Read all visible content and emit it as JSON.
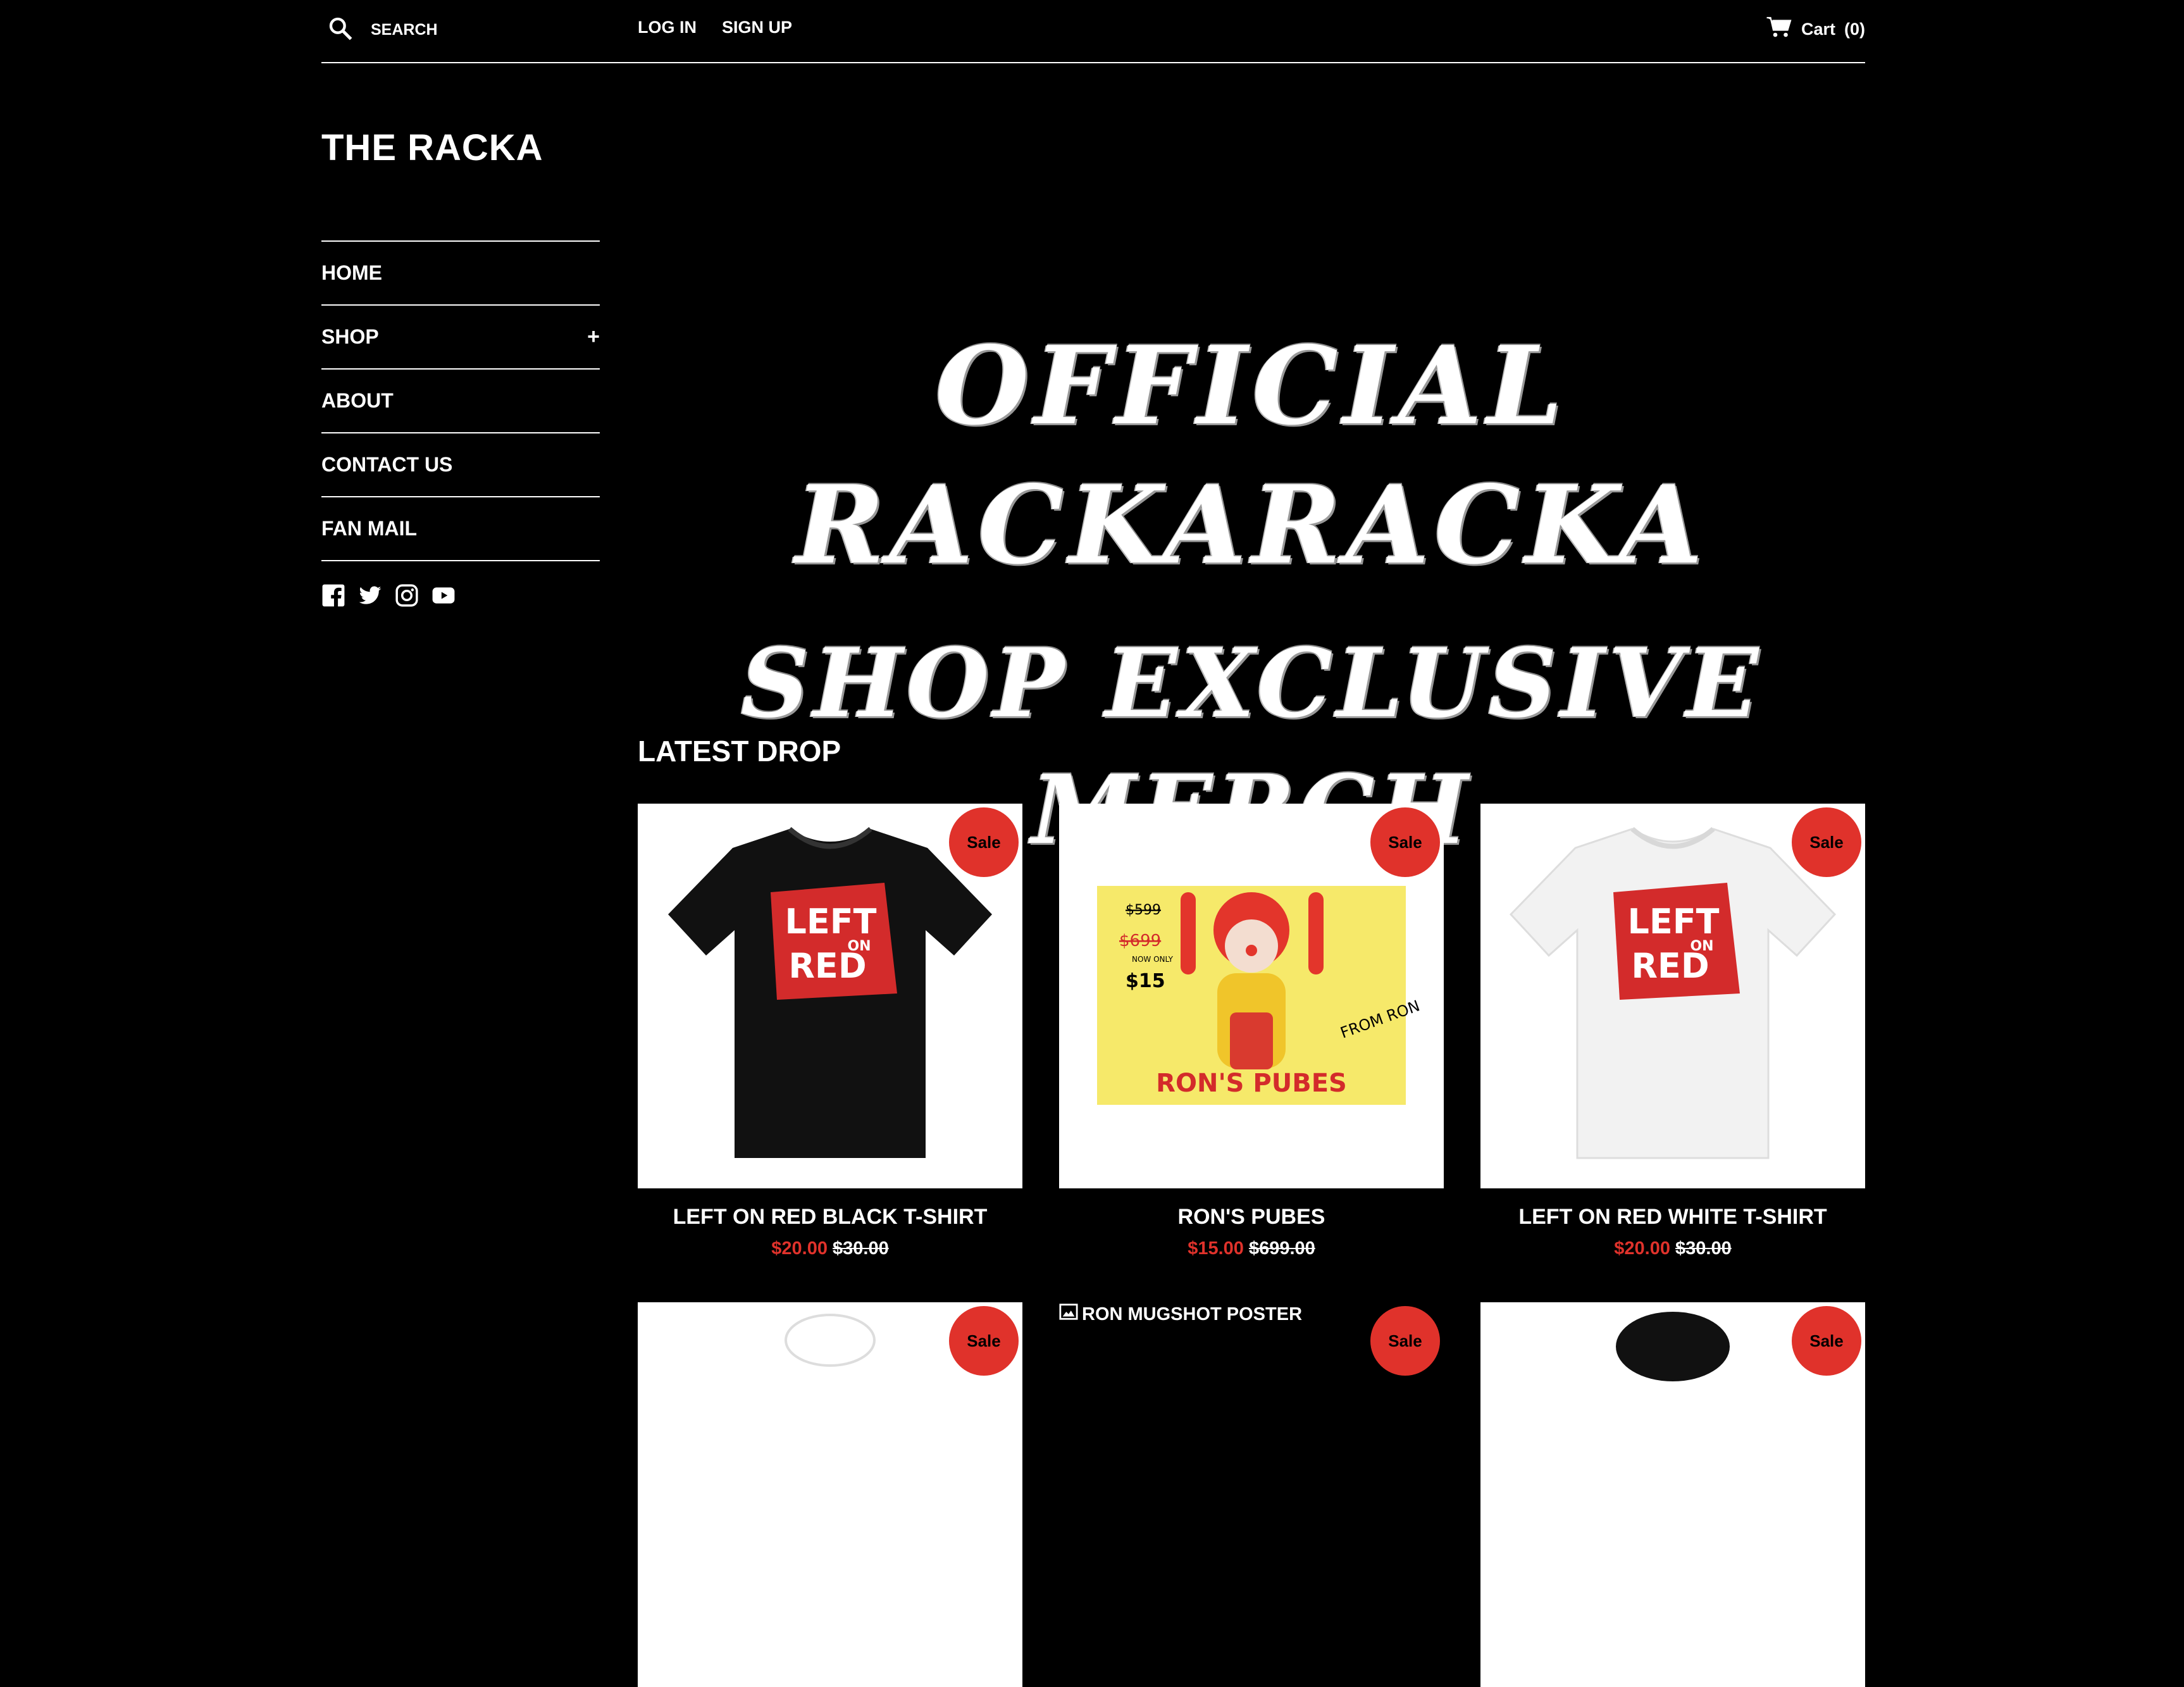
{
  "header": {
    "search_placeholder": "SEARCH",
    "login": "LOG IN",
    "signup": "SIGN UP",
    "cart_label": "Cart",
    "cart_count": "(0)"
  },
  "sidebar": {
    "brand": "THE RACKA",
    "nav": [
      {
        "label": "HOME"
      },
      {
        "label": "SHOP",
        "expand": "+"
      },
      {
        "label": "ABOUT"
      },
      {
        "label": "CONTACT US"
      },
      {
        "label": "FAN MAIL"
      }
    ],
    "social_icons": [
      "facebook-icon",
      "twitter-icon",
      "instagram-icon",
      "youtube-icon"
    ]
  },
  "hero": {
    "line1": "OFFICIAL RACKARACKA",
    "line2": "SHOP EXCLUSIVE MERCH"
  },
  "latest": {
    "title": "LATEST DROP",
    "sale_badge": "Sale",
    "products": [
      {
        "title": "LEFT ON RED BLACK T-SHIRT",
        "price": "$20.00",
        "compare": "$30.00"
      },
      {
        "title": "RON'S PUBES",
        "price": "$15.00",
        "compare": "$699.00"
      },
      {
        "title": "LEFT ON RED WHITE T-SHIRT",
        "price": "$20.00",
        "compare": "$30.00"
      }
    ],
    "row2": [
      {
        "alt": ""
      },
      {
        "alt": "RON MUGSHOT POSTER"
      },
      {
        "alt": ""
      }
    ]
  },
  "art": {
    "shirt_print_line1": "LEFT",
    "shirt_print_line2": "ON",
    "shirt_print_line3": "RED",
    "pubes_caption": "RON'S PUBES",
    "pubes_price_strike": "$599",
    "pubes_price_strike2": "$699",
    "pubes_now": "NOW ONLY",
    "pubes_new": "$15",
    "pubes_from": "FROM RON"
  },
  "colors": {
    "sale": "#e0322b",
    "background": "#000000",
    "text": "#ffffff"
  }
}
